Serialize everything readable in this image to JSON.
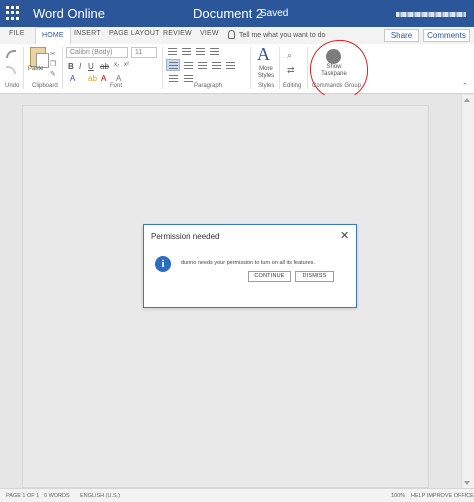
{
  "titlebar": {
    "app_name": "Word Online",
    "document_name": "Document 2",
    "status": "Saved"
  },
  "tabs": [
    {
      "label": "FILE"
    },
    {
      "label": "HOME",
      "active": true
    },
    {
      "label": "INSERT"
    },
    {
      "label": "PAGE LAYOUT"
    },
    {
      "label": "REVIEW"
    },
    {
      "label": "VIEW"
    }
  ],
  "tellme": {
    "text": "Tell me what you want to do"
  },
  "header_buttons": {
    "share": "Share",
    "comments": "Comments"
  },
  "ribbon": {
    "clipboard": {
      "paste_label": "Paste",
      "group_label": "Clipboard"
    },
    "undo_label": "Undo",
    "font": {
      "family": "Calibri (Body)",
      "size": "11",
      "group_label": "Font"
    },
    "paragraph": {
      "group_label": "Paragraph"
    },
    "styles": {
      "button_label": "More Styles",
      "group_label": "Styles"
    },
    "editing": {
      "group_label": "Editing"
    },
    "commands": {
      "button_label": "Show Taskpane",
      "group_label": "Commands Group"
    }
  },
  "dialog": {
    "title": "Permission needed",
    "message": "dunno needs your permission to turn on all its features.",
    "continue_label": "CONTINUE",
    "dismiss_label": "DISMISS"
  },
  "statusbar": {
    "page": "PAGE 1 OF 1",
    "words": "0 WORDS",
    "language": "ENGLISH (U.S.)",
    "zoom": "100%",
    "help": "HELP IMPROVE OFFICE"
  },
  "colors": {
    "titlebar": "#2b579a",
    "annotation_ring": "#e02020",
    "dialog_border": "#3c78c8",
    "info_icon": "#2b6cc4"
  }
}
